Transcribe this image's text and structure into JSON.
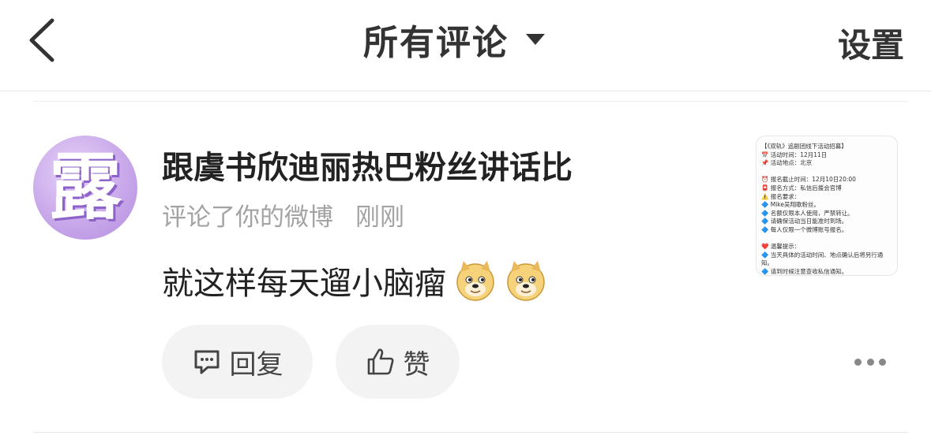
{
  "header": {
    "title": "所有评论",
    "settings_label": "设置"
  },
  "comment": {
    "avatar_glyph": "露",
    "username": "跟虞书欣迪丽热巴粉丝讲话比",
    "meta_action": "评论了你的微博",
    "meta_time": "刚刚",
    "text": "就这样每天遛小脑瘤",
    "emojis": [
      "doge-emoji",
      "doge-emoji"
    ]
  },
  "thumbnail": {
    "lines": [
      "【《双轨》追剧团线下活动招募】",
      "📅 活动时间：12月11日",
      "📌 活动地点：北京",
      "",
      "⏰ 报名截止时间：12月10日20:00",
      "📮 报名方式：私信后援会官博",
      "⚠️ 报名要求：",
      "🔷 Mike吴翔歌粉丝。",
      "🔷 名额仅限本人使用，严禁转让。",
      "🔷 请确保活动当日能准时到场。",
      "🔷 每人仅限一个微博账号报名。",
      "",
      "❤️ 温馨提示：",
      "🔷 当天具体的活动时间、地点确认后将另行通",
      "知。",
      "🔷 请到时候注意查收私信通知。"
    ]
  },
  "actions": {
    "reply_label": "回复",
    "like_label": "赞"
  },
  "colors": {
    "text_primary": "#222222",
    "text_secondary": "#a3a3a3",
    "pill_bg": "#f3f3f3",
    "avatar_purple": "#b38ddf"
  }
}
